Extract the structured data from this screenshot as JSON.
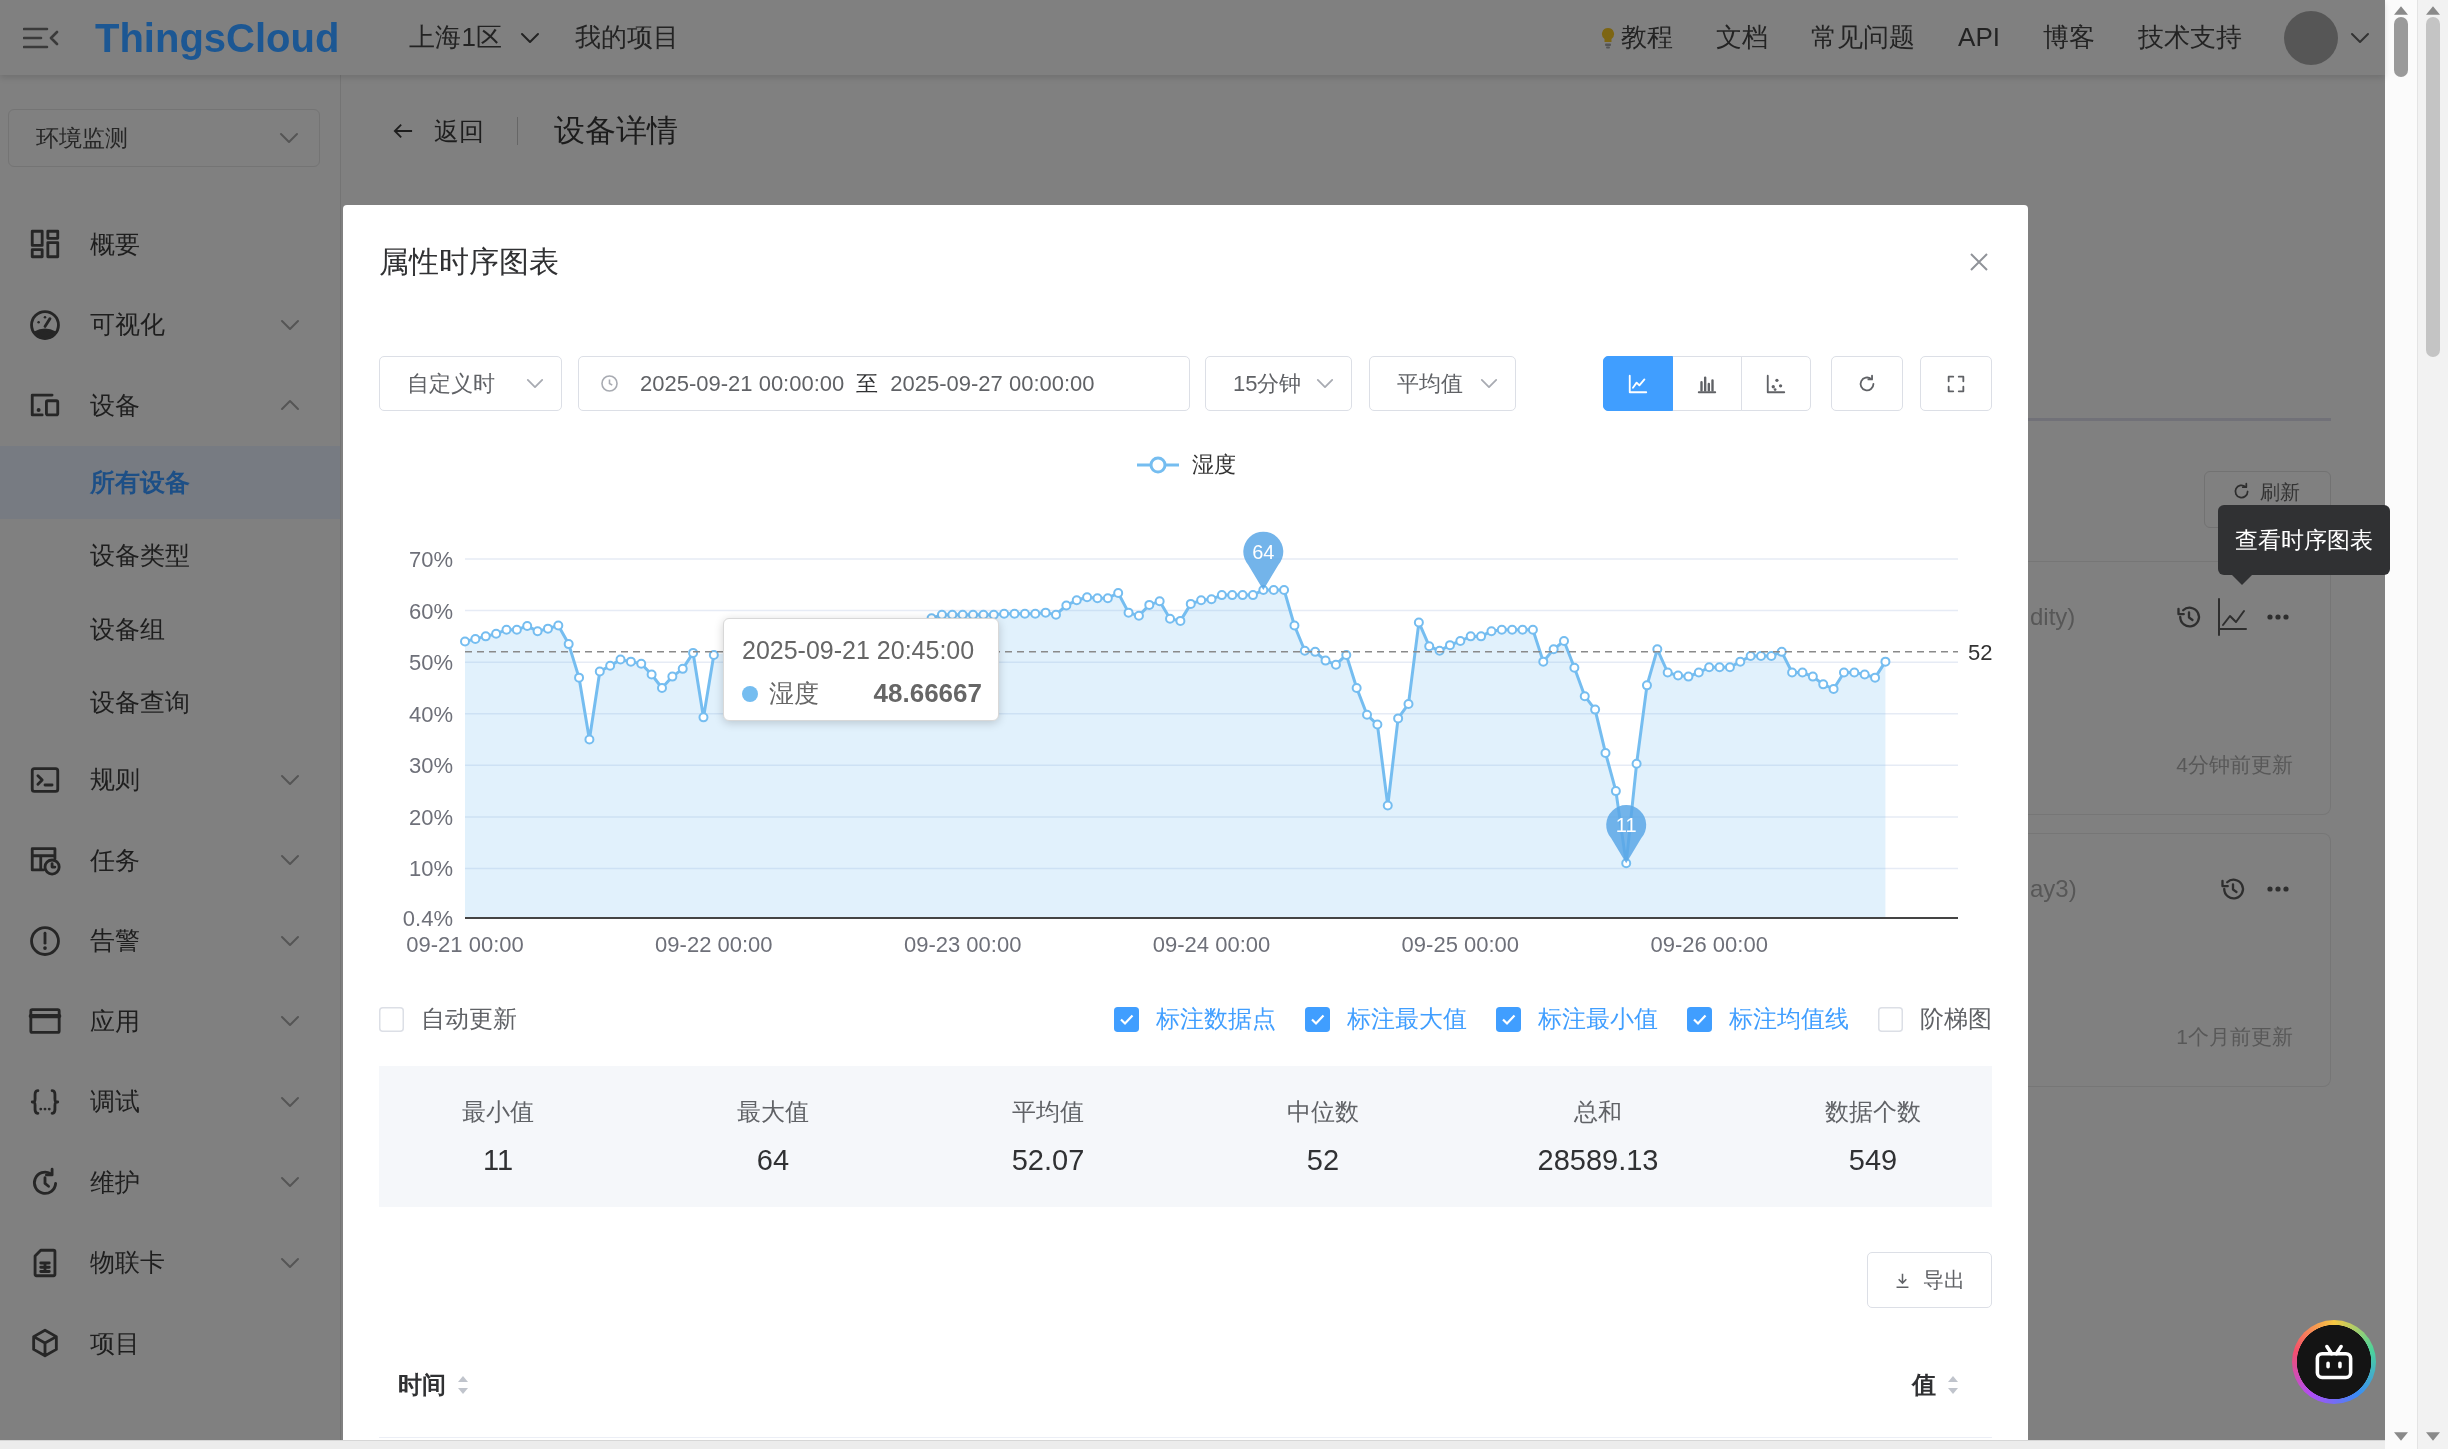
{
  "header": {
    "logo": "ThingsCloud",
    "region": "上海1区",
    "project_link": "我的项目",
    "links": [
      {
        "label": "教程",
        "kind": "tip"
      },
      {
        "label": "文档",
        "kind": "plain"
      },
      {
        "label": "常见问题",
        "kind": "plain"
      },
      {
        "label": "API",
        "kind": "plain"
      },
      {
        "label": "博客",
        "kind": "plain"
      },
      {
        "label": "技术支持",
        "kind": "plain"
      }
    ]
  },
  "sidebar": {
    "project_select": "环境监测",
    "items": [
      {
        "label": "概要",
        "selected": false
      },
      {
        "label": "可视化",
        "selected": false,
        "expanded": false
      },
      {
        "label": "设备",
        "selected": false,
        "expanded": true,
        "children": [
          {
            "label": "所有设备",
            "selected": true
          },
          {
            "label": "设备类型",
            "selected": false
          },
          {
            "label": "设备组",
            "selected": false
          },
          {
            "label": "设备查询",
            "selected": false
          }
        ]
      },
      {
        "label": "规则",
        "selected": false,
        "expanded": false
      },
      {
        "label": "任务",
        "selected": false,
        "expanded": false
      },
      {
        "label": "告警",
        "selected": false,
        "expanded": false
      },
      {
        "label": "应用",
        "selected": false,
        "expanded": false
      },
      {
        "label": "调试",
        "selected": false,
        "expanded": false
      },
      {
        "label": "维护",
        "selected": false,
        "expanded": false
      },
      {
        "label": "物联卡",
        "selected": false,
        "expanded": false
      },
      {
        "label": "项目",
        "selected": false
      }
    ]
  },
  "page": {
    "back": "返回",
    "title": "设备详情"
  },
  "property_panel": {
    "refresh": "刷新",
    "tooltip": "查看时序图表",
    "cards": [
      {
        "title": "dity)",
        "chart_action": true,
        "updated": "4分钟前更新"
      },
      {
        "title": "ay3)",
        "chart_action": false,
        "updated": "1个月前更新"
      }
    ]
  },
  "modal": {
    "title": "属性时序图表",
    "toolbar": {
      "range_type": "自定义时",
      "start": "2025-09-21 00:00:00",
      "separator": "至",
      "end": "2025-09-27 00:00:00",
      "interval": "15分钟",
      "aggregate": "平均值",
      "chart_types": [
        {
          "kind": "line",
          "selected": true
        },
        {
          "kind": "bar",
          "selected": false
        },
        {
          "kind": "scatter",
          "selected": false
        }
      ]
    },
    "chart": {
      "chart_data": {
        "type": "area",
        "grid": true,
        "ylim": [
          0.4,
          70
        ],
        "yticks": [
          {
            "value": 0.4,
            "label": "0.4%"
          },
          {
            "value": 10,
            "label": "10%"
          },
          {
            "value": 20,
            "label": "20%"
          },
          {
            "value": 30,
            "label": "30%"
          },
          {
            "value": 40,
            "label": "40%"
          },
          {
            "value": 50,
            "label": "50%"
          },
          {
            "value": 60,
            "label": "60%"
          },
          {
            "value": 70,
            "label": "70%"
          }
        ],
        "categories": [
          "09-21 00:00",
          null,
          null,
          null,
          null,
          null,
          null,
          null,
          null,
          null,
          null,
          null,
          null,
          null,
          null,
          null,
          null,
          null,
          null,
          null,
          null,
          null,
          null,
          null,
          "09-22 00:00",
          null,
          null,
          null,
          null,
          null,
          null,
          null,
          null,
          null,
          null,
          null,
          null,
          null,
          null,
          null,
          null,
          null,
          null,
          null,
          null,
          null,
          null,
          null,
          "09-23 00:00",
          null,
          null,
          null,
          null,
          null,
          null,
          null,
          null,
          null,
          null,
          null,
          null,
          null,
          null,
          null,
          null,
          null,
          null,
          null,
          null,
          null,
          null,
          null,
          "09-24 00:00",
          null,
          null,
          null,
          null,
          null,
          null,
          null,
          null,
          null,
          null,
          null,
          null,
          null,
          null,
          null,
          null,
          null,
          null,
          null,
          null,
          null,
          null,
          null,
          "09-25 00:00",
          null,
          null,
          null,
          null,
          null,
          null,
          null,
          null,
          null,
          null,
          null,
          null,
          null,
          null,
          null,
          null,
          null,
          null,
          null,
          null,
          null,
          null,
          null,
          "09-26 00:00",
          null,
          null,
          null,
          null,
          null,
          null,
          null,
          null,
          null,
          null,
          null,
          null,
          null,
          null,
          null,
          null,
          null,
          null,
          null,
          null,
          null,
          null,
          null,
          null
        ],
        "series": [
          {
            "name": "湿度",
            "color": "#75bdf0",
            "values": [
              54,
              54.5,
              55,
              55.5,
              56.3,
              56.3,
              57,
              56,
              56.5,
              57.1,
              53.5,
              47,
              35,
              48.2,
              49.3,
              50.5,
              50.1,
              49.7,
              47.6,
              45,
              47.2,
              48.7,
              51.8,
              39.3,
              51.4,
              null,
              null,
              null,
              null,
              null,
              null,
              null,
              null,
              null,
              null,
              null,
              null,
              null,
              null,
              null,
              null,
              null,
              null,
              null,
              null,
              58.5,
              59.2,
              59.2,
              59.2,
              59.2,
              59.2,
              59.2,
              59.4,
              59.4,
              59.4,
              59.4,
              59.6,
              59.2,
              61,
              62,
              62.6,
              62.4,
              62.4,
              63.4,
              59.6,
              59,
              61.1,
              61.8,
              58.4,
              58,
              61.3,
              62,
              62.2,
              63,
              63,
              63,
              63,
              64,
              64,
              64,
              57.1,
              52.2,
              52,
              50.3,
              49.5,
              51.4,
              45,
              39.8,
              37.9,
              22.2,
              39.1,
              41.9,
              57.7,
              53.1,
              52.2,
              53.3,
              54.1,
              55,
              55,
              56,
              56.3,
              56.3,
              56.3,
              56.3,
              50.1,
              52.5,
              54.1,
              48.9,
              43.4,
              40.8,
              32.4,
              25,
              11,
              30.3,
              45.5,
              52.5,
              48,
              47.4,
              47.2,
              48,
              49,
              49,
              49,
              50.1,
              51.2,
              51.2,
              51.2,
              52,
              48,
              48,
              47.2,
              45.7,
              44.8,
              48,
              48,
              47.6,
              47,
              50.1,
              null,
              null,
              null,
              null,
              null,
              null,
              null
            ]
          }
        ],
        "annotations": [
          {
            "text": "64",
            "y": 64
          },
          {
            "text": "11",
            "y": 11
          }
        ],
        "ref_lines": [
          {
            "axis": "y",
            "value": 52,
            "label": "52"
          }
        ]
      },
      "tooltip": {
        "time": "2025-09-21 20:45:00",
        "series": "湿度",
        "value": "48.66667"
      }
    },
    "options": [
      {
        "label": "自动更新",
        "checked": false
      },
      {
        "label": "标注数据点",
        "checked": true
      },
      {
        "label": "标注最大值",
        "checked": true
      },
      {
        "label": "标注最小值",
        "checked": true
      },
      {
        "label": "标注均值线",
        "checked": true
      },
      {
        "label": "阶梯图",
        "checked": false
      }
    ],
    "stats": [
      {
        "label": "最小值",
        "value": "11"
      },
      {
        "label": "最大值",
        "value": "64"
      },
      {
        "label": "平均值",
        "value": "52.07"
      },
      {
        "label": "中位数",
        "value": "52"
      },
      {
        "label": "总和",
        "value": "28589.13"
      },
      {
        "label": "数据个数",
        "value": "549"
      }
    ],
    "export": "导出",
    "table": {
      "columns": [
        {
          "label": "时间"
        },
        {
          "label": "值"
        }
      ]
    }
  }
}
